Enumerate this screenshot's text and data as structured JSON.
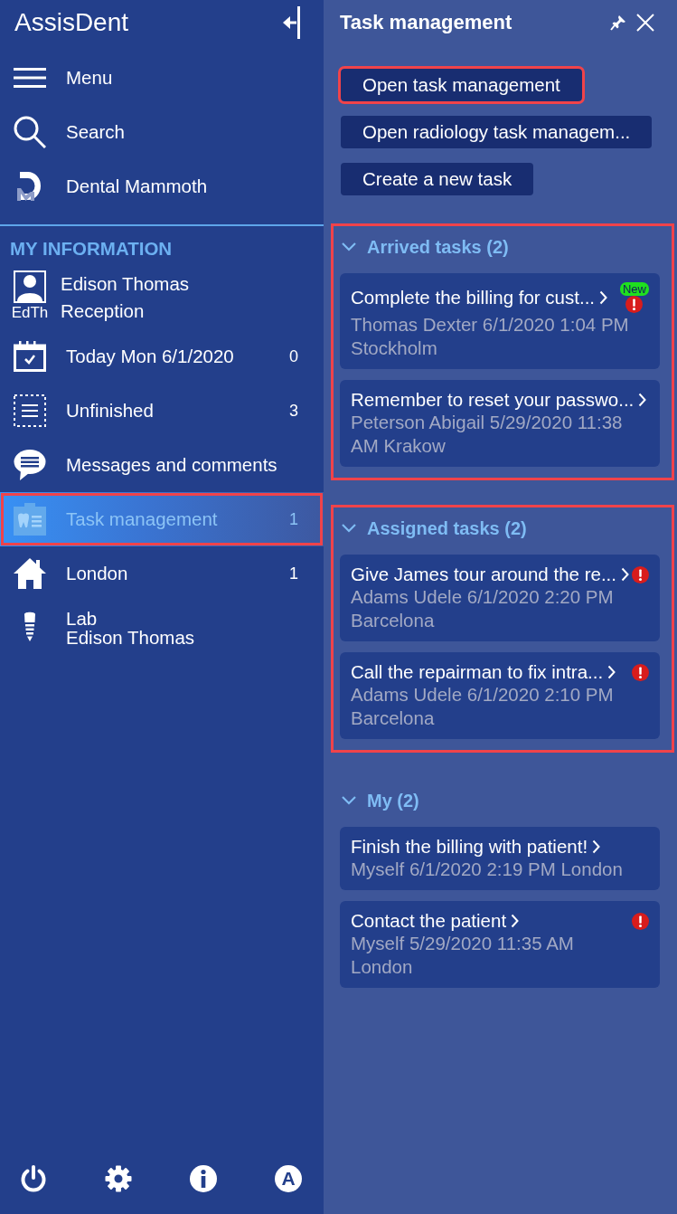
{
  "sidebar": {
    "app_title": "AssisDent",
    "top_items": [
      {
        "label": "Menu"
      },
      {
        "label": "Search"
      },
      {
        "label": "Dental Mammoth"
      }
    ],
    "section_title": "MY INFORMATION",
    "user": {
      "name": "Edison Thomas",
      "role": "Reception",
      "initials": "EdTh"
    },
    "items": [
      {
        "label": "Today Mon 6/1/2020",
        "count": "0",
        "selected": false,
        "highlighted": false
      },
      {
        "label": "Unfinished",
        "count": "3",
        "selected": false,
        "highlighted": false
      },
      {
        "label": "Messages and comments",
        "selected": false,
        "highlighted": false
      },
      {
        "label": "Task management",
        "count": "1",
        "selected": true,
        "highlighted": true
      },
      {
        "label": "London",
        "count": "1",
        "selected": false,
        "highlighted": false
      },
      {
        "label": "Lab",
        "sublabel": "Edison Thomas",
        "selected": false,
        "highlighted": false
      }
    ],
    "account_letter": "A"
  },
  "panel": {
    "title": "Task management",
    "buttons": [
      {
        "label": "Open task management",
        "highlighted": true
      },
      {
        "label": "Open radiology task managem...",
        "highlighted": false
      },
      {
        "label": "Create a new task",
        "highlighted": false
      }
    ],
    "sections": [
      {
        "title": "Arrived tasks (2)",
        "expanded": true,
        "highlighted": true,
        "tasks": [
          {
            "title": "Complete the billing for cust...",
            "details": "Thomas Dexter 6/1/2020 1:04 PM Stockholm",
            "badge": "New",
            "urgent": true
          },
          {
            "title": "Remember to reset your passwo...",
            "details": "Peterson Abigail 5/29/2020 11:38 AM Krakow",
            "urgent": false
          }
        ]
      },
      {
        "title": "Assigned tasks (2)",
        "expanded": true,
        "highlighted": true,
        "tasks": [
          {
            "title": "Give James tour around the re...",
            "details": "Adams Udele 6/1/2020 2:20 PM Barcelona",
            "urgent": true
          },
          {
            "title": "Call the repairman to fix intra...",
            "details": "Adams Udele 6/1/2020 2:10 PM Barcelona",
            "urgent": true
          }
        ]
      },
      {
        "title": "My (2)",
        "expanded": true,
        "highlighted": false,
        "tasks": [
          {
            "title": "Finish the billing with patient!",
            "details": "Myself 6/1/2020 2:19 PM London",
            "urgent": false
          },
          {
            "title": "Contact the patient",
            "details": "Myself 5/29/2020 11:35 AM London",
            "urgent": true
          }
        ]
      }
    ]
  }
}
